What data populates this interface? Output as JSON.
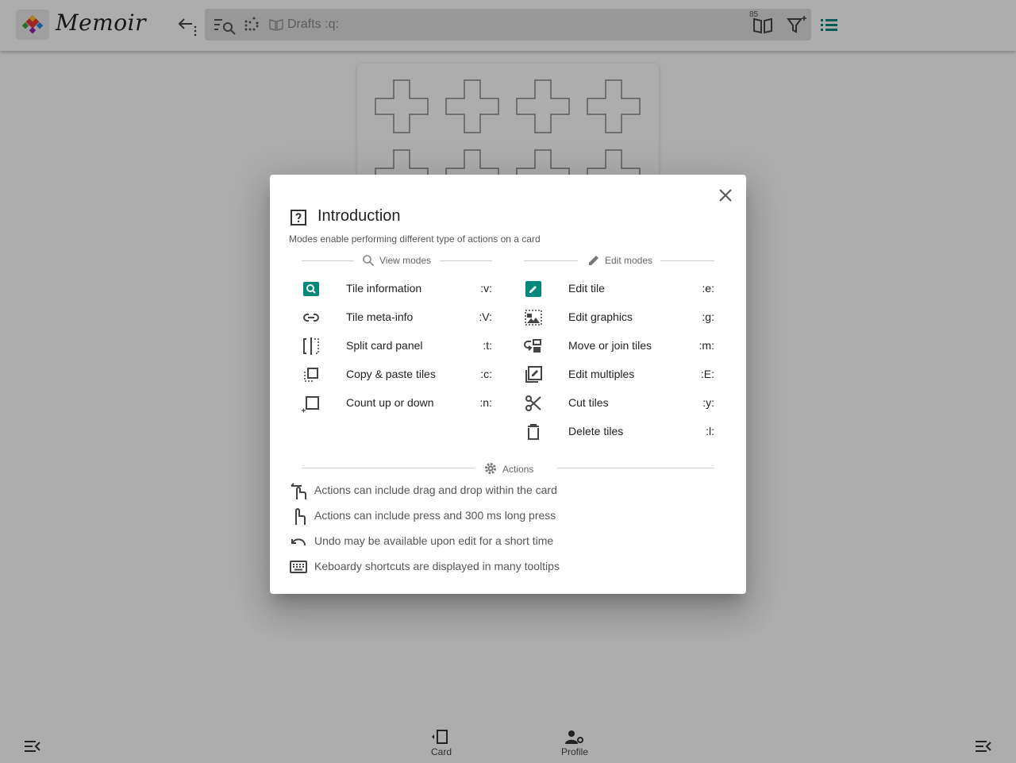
{
  "app": {
    "name": "Memoir",
    "search_text": "Drafts :q:",
    "badge_count": "85",
    "colors": {
      "accent": "#00897b",
      "text": "#222222"
    }
  },
  "bottom_nav": {
    "card_label": "Card",
    "profile_label": "Profile"
  },
  "dialog": {
    "title": "Introduction",
    "subtitle": "Modes enable performing different type of actions on a card",
    "view_modes": {
      "heading": "View modes",
      "items": [
        {
          "label": "Tile information",
          "key": ":v:",
          "icon": "search-icon"
        },
        {
          "label": "Tile meta-info",
          "key": ":V:",
          "icon": "link-icon"
        },
        {
          "label": "Split card panel",
          "key": ":t:",
          "icon": "split-panel-icon"
        },
        {
          "label": "Copy & paste tiles",
          "key": ":c:",
          "icon": "copy-icon"
        },
        {
          "label": "Count up or down",
          "key": ":n:",
          "icon": "counter-icon"
        }
      ]
    },
    "edit_modes": {
      "heading": "Edit modes",
      "items": [
        {
          "label": "Edit tile",
          "key": ":e:",
          "icon": "edit-icon"
        },
        {
          "label": "Edit graphics",
          "key": ":g:",
          "icon": "image-icon"
        },
        {
          "label": "Move or join tiles",
          "key": ":m:",
          "icon": "move-icon"
        },
        {
          "label": "Edit multiples",
          "key": ":E:",
          "icon": "edit-multiple-icon"
        },
        {
          "label": "Cut tiles",
          "key": ":y:",
          "icon": "scissors-icon"
        },
        {
          "label": "Delete tiles",
          "key": ":l:",
          "icon": "trash-icon"
        }
      ]
    },
    "actions": {
      "heading": "Actions",
      "items": [
        {
          "label": "Actions can include drag and drop within the card",
          "icon": "swipe-icon"
        },
        {
          "label": "Actions can include press and 300 ms long press",
          "icon": "touch-icon"
        },
        {
          "label": "Undo may be available upon edit for a short time",
          "icon": "undo-icon"
        },
        {
          "label": "Keboardy shortcuts are displayed in many tooltips",
          "icon": "keyboard-icon"
        }
      ]
    }
  }
}
